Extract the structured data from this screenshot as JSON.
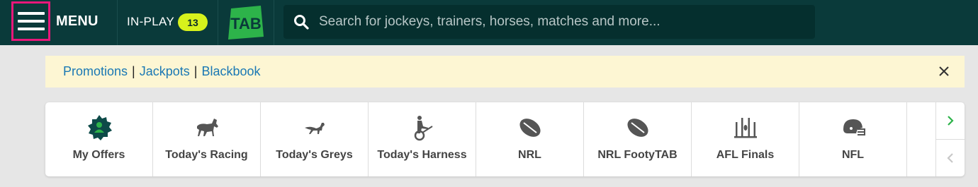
{
  "header": {
    "menu_label": "MENU",
    "inplay_label": "IN-PLAY",
    "inplay_count": "13",
    "logo_text": "TAB",
    "search_placeholder": "Search for jockeys, trainers, horses, matches and more..."
  },
  "banner": {
    "links": [
      "Promotions",
      "Jackpots",
      "Blackbook"
    ],
    "separator": "|"
  },
  "categories": [
    {
      "label": "My Offers",
      "icon": "offers-badge-icon"
    },
    {
      "label": "Today's Racing",
      "icon": "horse-icon"
    },
    {
      "label": "Today's Greys",
      "icon": "greyhound-icon"
    },
    {
      "label": "Today's Harness",
      "icon": "harness-icon"
    },
    {
      "label": "NRL",
      "icon": "rugby-ball-icon"
    },
    {
      "label": "NRL FootyTAB",
      "icon": "rugby-ball-icon"
    },
    {
      "label": "AFL Finals",
      "icon": "afl-goalposts-icon"
    },
    {
      "label": "NFL",
      "icon": "football-helmet-icon"
    }
  ],
  "colors": {
    "header_bg": "#0a3a3a",
    "accent_green": "#2db34a",
    "badge_yellow": "#d7f21c",
    "link_blue": "#1a78b4",
    "highlight_pink": "#e8177a"
  }
}
